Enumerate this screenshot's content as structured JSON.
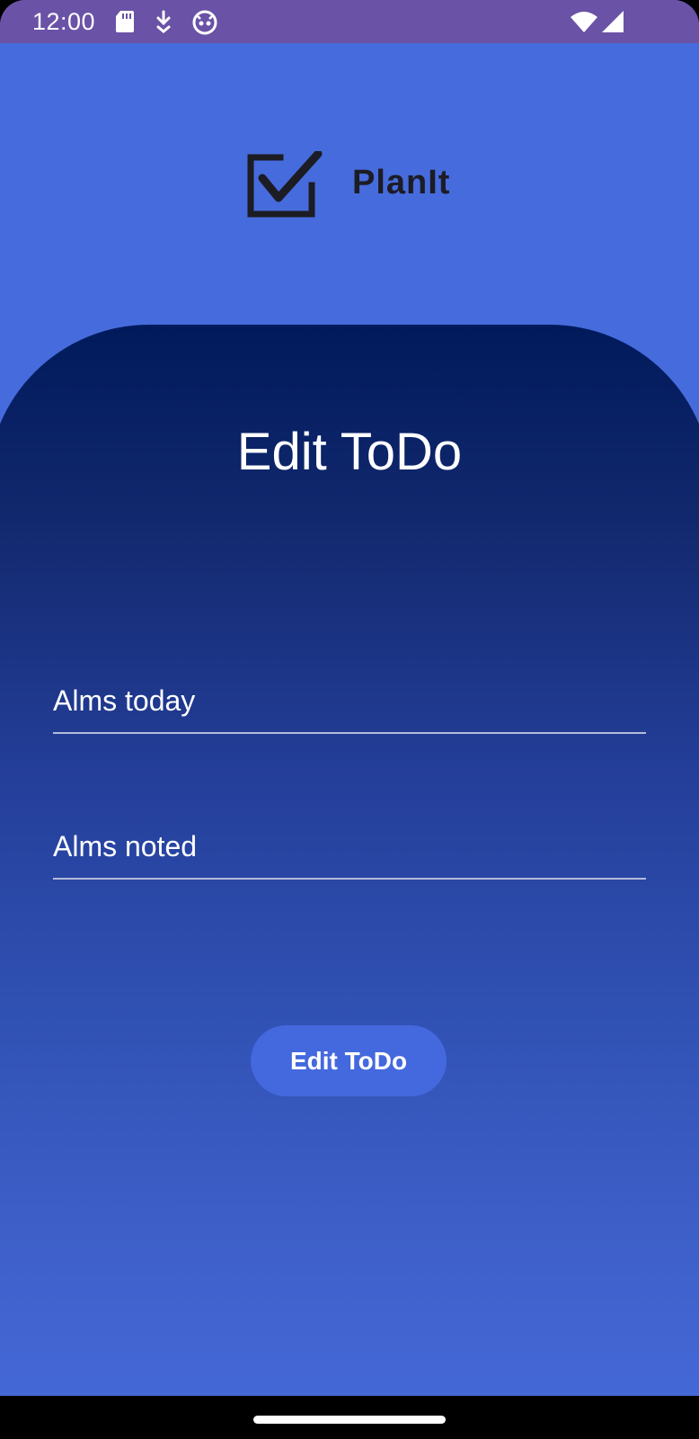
{
  "status_bar": {
    "time": "12:00",
    "icons": [
      "sd-card-icon",
      "download-icon",
      "android-face-icon",
      "wifi-icon",
      "cellular-signal-icon"
    ]
  },
  "app": {
    "logo_text": "PlanIt",
    "title": "Edit ToDo",
    "fields": {
      "title_value": "Alms today",
      "description_value": "Alms noted"
    },
    "submit_label": "Edit ToDo"
  },
  "colors": {
    "status_bar": "#6a52a6",
    "background": "#466bdc",
    "card_top": "#001a5b",
    "button": "#4468dd",
    "text": "#ffffff"
  }
}
